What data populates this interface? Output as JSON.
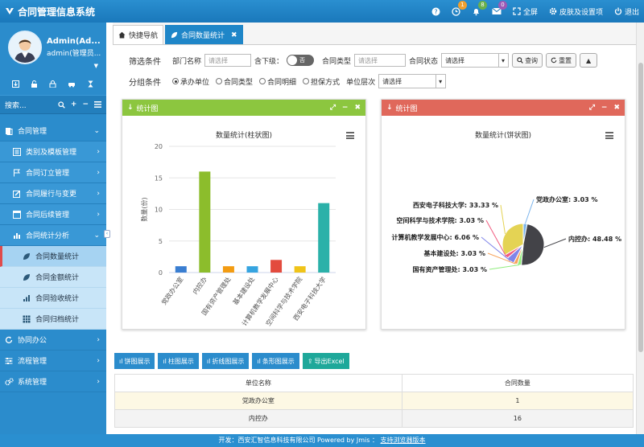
{
  "app": {
    "title": "合同管理信息系统"
  },
  "topbar": {
    "badges": {
      "clock": "1",
      "bell": "8",
      "mail": "0"
    },
    "fullscreen": "全屏",
    "skin": "皮肤及设置项",
    "logout": "退出"
  },
  "profile": {
    "name": "Admin(Ad...",
    "role": "admin(管理员..."
  },
  "search": {
    "label": "搜索..."
  },
  "menu": {
    "contract": "合同管理",
    "templates": "类别及模板管理",
    "create": "合同订立管理",
    "perform": "合同履行与变更",
    "followup": "合同后续管理",
    "stats": "合同统计分析",
    "qty": "合同数量统计",
    "amount": "合同金额统计",
    "acceptance": "合同验收统计",
    "archive": "合同归档统计",
    "office": "协同办公",
    "flow": "流程管理",
    "system": "系统管理"
  },
  "tabs": {
    "home": "快捷导航",
    "current": "合同数量统计"
  },
  "filter": {
    "label": "筛选条件",
    "dept": "部门名称",
    "dept_placeholder": "请选择",
    "sub": "含下级：",
    "toggle": "否",
    "type": "合同类型",
    "type_placeholder": "请选择",
    "status": "合同状态",
    "status_value": "请选择",
    "query": "查询",
    "reset": "重置"
  },
  "group": {
    "label": "分组条件",
    "options": [
      "承办单位",
      "合同类型",
      "合同明细",
      "担保方式"
    ],
    "level": "单位层次",
    "level_value": "请选择"
  },
  "panels": {
    "left": "统计图",
    "right": "统计图"
  },
  "bar_chart_title": "数量统计(柱状图)",
  "pie_chart_title": "数量统计(饼状图)",
  "chart_data": [
    {
      "type": "bar",
      "title": "数量统计(柱状图)",
      "ylabel": "数量(份)",
      "ylim": [
        0,
        20
      ],
      "yticks": [
        "0",
        "5",
        "10",
        "15",
        "20"
      ],
      "categories": [
        "党政办公室",
        "内控办",
        "国有资产管理处",
        "基本建设处",
        "计算机教学发展中心",
        "空间科学与技术学院",
        "西安电子科技大学"
      ],
      "values": [
        1,
        16,
        1,
        1,
        2,
        1,
        11
      ],
      "colors": [
        "#3a7ed1",
        "#8cbd2c",
        "#f39c12",
        "#36a4e0",
        "#e34b3e",
        "#f0c419",
        "#2bb1a9"
      ]
    },
    {
      "type": "pie",
      "title": "数量统计(饼状图)",
      "labels": [
        "党政办公室: 3.03 %",
        "内控办: 48.48 %",
        "国有资产管理处: 3.03 %",
        "基本建设处: 3.03 %",
        "计算机教学发展中心: 6.06 %",
        "空间科学与技术学院: 3.03 %",
        "西安电子科技大学: 33.33 %"
      ],
      "values": [
        3.03,
        48.48,
        3.03,
        3.03,
        6.06,
        3.03,
        33.33
      ],
      "colors": [
        "#7cb5ec",
        "#434348",
        "#90ed7d",
        "#f7a35c",
        "#8085e9",
        "#f15c80",
        "#e4d354"
      ]
    }
  ],
  "buttons": {
    "pie": "饼图展示",
    "bar": "柱图展示",
    "line": "折线图展示",
    "strip": "条形图展示",
    "export": "导出Excel"
  },
  "table": {
    "headers": [
      "单位名称",
      "合同数量"
    ],
    "rows": [
      [
        "党政办公室",
        "1"
      ],
      [
        "内控办",
        "16"
      ]
    ]
  },
  "footer": {
    "text": "开发：西安汇智信息科技有限公司 Powered by Jmis ：",
    "link": "支持浏览器版本"
  }
}
